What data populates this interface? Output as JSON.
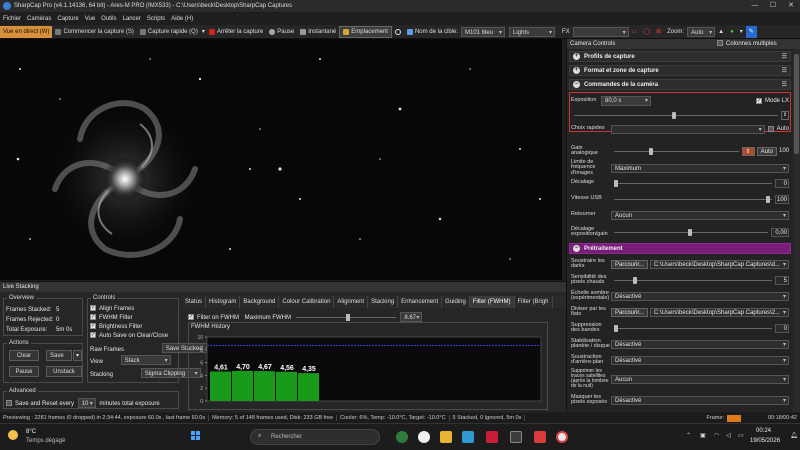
{
  "window": {
    "title": "SharpCap Pro (v4.1.14136, 64 bit) - Ares-M PRO (IMX533) - C:\\Users\\beck\\Desktop\\SharpCap Captures",
    "min": "—",
    "max": "☐",
    "close": "✕"
  },
  "menu": [
    "Fichier",
    "Caméras",
    "Capture",
    "Vue",
    "Outils",
    "Lancer",
    "Scripts",
    "Aide (H)"
  ],
  "toolbar": {
    "live": "Vue en direct (W)",
    "start_capture": "Commencer la capture (S)",
    "quick_capture": "Capture rapide (Q)",
    "stop_capture": "Arrêter la capture",
    "pause": "Pause",
    "snapshot": "Instantané",
    "placement": "Emplacement",
    "target_label": "Nom de la cible:",
    "target_value": "M101 bleu",
    "filter_value": "Lights",
    "fx_label": "FX",
    "fx_value": "",
    "zoom_label": "Zoom:",
    "zoom_value": "Auto"
  },
  "right_panel": {
    "header": "Camera Controls",
    "multi_columns": "Colonnes multiples",
    "sections": {
      "capture_profiles": "Profils de capture",
      "format": "Format et zone de capture",
      "camera_controls": "Commandes de la caméra",
      "preprocessing": "Prétraitement"
    },
    "exposure": {
      "label": "Exposition",
      "value": "80,0 s",
      "lx_mode": "Mode LX",
      "quick_choice": "Choix rapides",
      "auto": "Auto"
    },
    "gain": {
      "label": "Gain analogique",
      "auto": "Auto",
      "value": "100"
    },
    "limit": {
      "label": "Limite de fréquence d'images",
      "value": "Maximum"
    },
    "offset": {
      "label": "Décalage",
      "value": "0"
    },
    "usb": {
      "label": "Vitesse USB",
      "value": "100"
    },
    "flip": {
      "label": "Retourner",
      "value": "Aucun"
    },
    "exposure_gain_offset": {
      "label": "Décalage exposition/gain",
      "value": "0,00"
    },
    "subtract_darks": {
      "label": "Soustraire les darks",
      "browse": "Parcourir...",
      "path": "C:\\Users\\beck\\Desktop\\SharpCap Captures\\d..."
    },
    "hot_pixel": {
      "label": "Sensibilité des pixels chauds",
      "value": "5"
    },
    "dark_scale": {
      "label": "Échelle sombre (expérimentale)",
      "value": "Désactivé"
    },
    "divide_flats": {
      "label": "Diviser par les flats",
      "browse": "Parcourir...",
      "path": "C:\\Users\\beck\\Desktop\\SharpCap Captures\\2..."
    },
    "banding": {
      "label": "Suppression des bandes",
      "value": "0"
    },
    "stabilization": {
      "label": "Stabilisation planète / disque",
      "value": "Désactivé"
    },
    "bg_subtract": {
      "label": "Soustraction d'arrière-plan",
      "value": "Désactivé"
    },
    "satellite": {
      "label": "Supprimer les traces satellites (après la tombée de la nuit)",
      "value": "Aucun"
    },
    "mask": {
      "label": "Masquer les pixels exposés",
      "value": "Désactivé"
    }
  },
  "live_stack": {
    "title": "Live Stacking",
    "overview": {
      "title": "Overview",
      "rows": [
        {
          "label": "Frames Stacked:",
          "value": "5"
        },
        {
          "label": "Frames Rejected:",
          "value": "0"
        },
        {
          "label": "Total Exposure:",
          "value": "5m 0s"
        }
      ]
    },
    "controls": {
      "title": "Controls",
      "align": "Align Frames",
      "fwhm": "FWHM Filter",
      "brightness": "Brightness Filter",
      "autosave": "Auto Save on Clear/Close",
      "raw_label": "Raw Frames",
      "raw_value": "Save Stacked",
      "view_label": "View",
      "view_value": "Stack",
      "stacking_label": "Stacking",
      "stacking_value": "Sigma Clipping"
    },
    "actions": {
      "title": "Actions",
      "clear": "Clear",
      "save": "Save",
      "pause": "Pause",
      "unstack": "Unstack"
    },
    "advanced": {
      "title": "Advanced",
      "save_reset": "Save and Reset every",
      "minutes": "10",
      "suffix": "minutes total exposure"
    },
    "tabs": [
      "Status",
      "Histogram",
      "Background",
      "Colour Calibration",
      "Alignment",
      "Stacking",
      "Enhancement",
      "Guiding",
      "Filter (FWHM)",
      "Filter (Brigh"
    ],
    "active_tab": 8,
    "filter_fwhm": "Filter on FWHM",
    "max_fwhm_label": "Maximum FWHM",
    "max_fwhm_value": "8.67",
    "history_title": "FWHM History",
    "y_ticks": [
      "10",
      "8",
      "6",
      "4",
      "2",
      "0"
    ]
  },
  "chart_data": {
    "type": "bar",
    "categories": [
      "1",
      "2",
      "3",
      "4",
      "5"
    ],
    "values": [
      4.61,
      4.7,
      4.67,
      4.56,
      4.35
    ],
    "labels": [
      "4,61",
      "4,70",
      "4,67",
      "4,56",
      "4,35"
    ],
    "threshold": 8.67,
    "ylim": [
      0,
      10
    ],
    "title": "FWHM History",
    "bar_color": "#1a9a1a",
    "threshold_color": "#3b3bd8"
  },
  "status": {
    "preview": "Previewing : 2281 frames (0 dropped) in 2:34:44, exposure 60.0s , last frame 60.0s",
    "memory": "Memory: 5 of 148 frames used, Disk: 233 GB free",
    "cooler": "Cooler: 6%, Temp: -10.0°C, Target: -10.0°C",
    "stacked": "5 Stacked, 0 Ignored, 5m 0s",
    "frame_label": "Frame:",
    "time": "00:18/00:42"
  },
  "taskbar": {
    "weather_temp": "8°C",
    "weather_desc": "Temps dégagé",
    "search_placeholder": "Rechercher",
    "clock_time": "00:24",
    "clock_date": "19/05/2026"
  },
  "colors": {
    "accent": "#d9903a",
    "preprocessing": "#7a1c7a",
    "stop": "#cc2222"
  }
}
